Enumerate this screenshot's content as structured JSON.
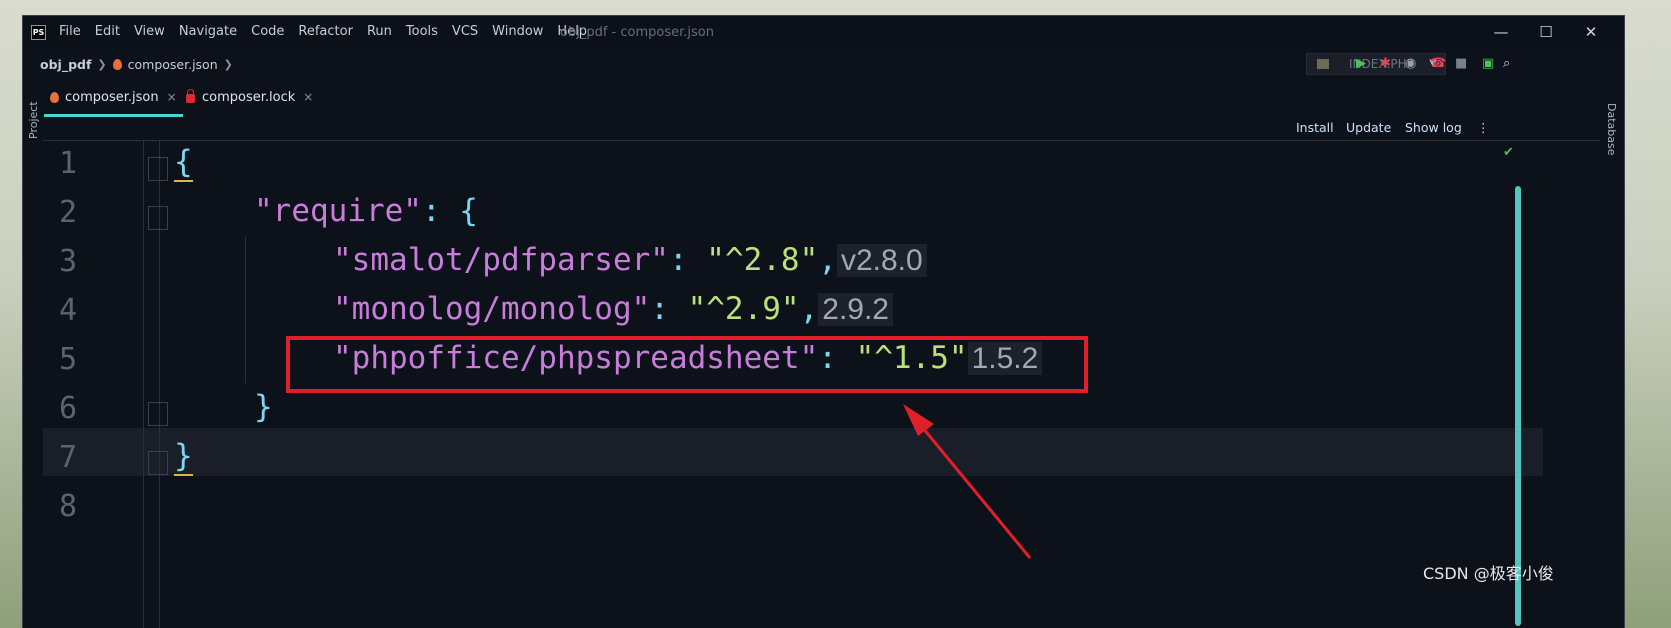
{
  "app": {
    "logo": "PS",
    "title": "obj_pdf - composer.json",
    "menu": [
      "File",
      "Edit",
      "View",
      "Navigate",
      "Code",
      "Refactor",
      "Run",
      "Tools",
      "VCS",
      "Window",
      "Help"
    ],
    "window_controls": {
      "minimize": "—",
      "maximize": "☐",
      "close": "✕"
    }
  },
  "breadcrumb": {
    "project": "obj_pdf",
    "file": "composer.json"
  },
  "run_config": {
    "label": "INDEX.PHP"
  },
  "tabs": [
    {
      "label": "composer.json",
      "close": "×"
    },
    {
      "label": "composer.lock",
      "close": "×"
    }
  ],
  "side_tools": {
    "left": "Project",
    "right": "Database"
  },
  "composer_actions": {
    "install": "Install",
    "update": "Update",
    "show_log": "Show log"
  },
  "editor": {
    "line_numbers": [
      "1",
      "2",
      "3",
      "4",
      "5",
      "6",
      "7",
      "8"
    ],
    "lines": {
      "l1": "{",
      "l2_key": "\"require\"",
      "l2_rest": ": {",
      "l3_key": "\"smalot/pdfparser\"",
      "l3_val": "\"^2.8\"",
      "l3_hint": "v2.8.0",
      "l4_key": "\"monolog/monolog\"",
      "l4_val": "\"^2.9\"",
      "l4_hint": "2.9.2",
      "l5_key": "\"phpoffice/phpspreadsheet\"",
      "l5_val": "\"^1.5\"",
      "l5_hint": "1.5.2",
      "l6": "}",
      "l7": "}"
    },
    "punct": {
      "colon": ": ",
      "comma": ","
    }
  },
  "watermark": "CSDN @极客小俊",
  "colors": {
    "annotation": "#e02028",
    "keys": "#c77dd9",
    "strings": "#b9e07a",
    "braces": "#7dd6f0"
  }
}
